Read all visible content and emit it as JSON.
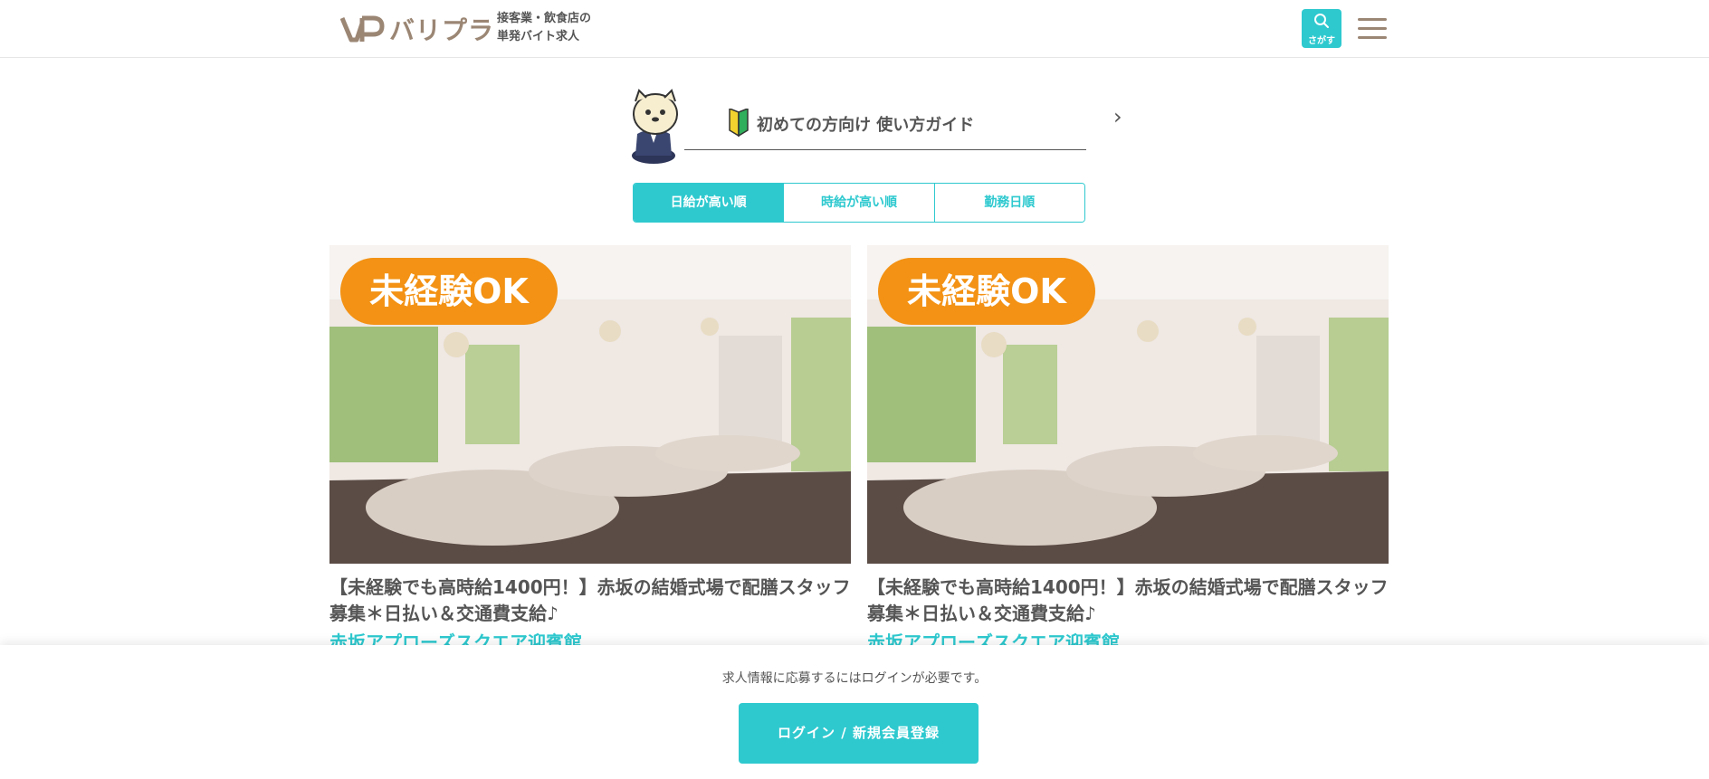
{
  "header": {
    "logo_text": "バリプラ",
    "tagline_line1": "接客業・飲食店の",
    "tagline_line2": "単発バイト求人",
    "search_label": "さがす"
  },
  "guide": {
    "text": "初めての方向け 使い方ガイド"
  },
  "sort_tabs": [
    {
      "label": "日給が高い順",
      "active": true
    },
    {
      "label": "時給が高い順",
      "active": false
    },
    {
      "label": "勤務日順",
      "active": false
    }
  ],
  "jobs": [
    {
      "badge": "未経験OK",
      "title": "【未経験でも高時給1400円！】赤坂の結婚式場で配膳スタッフ募集＊日払い＆交通費支給♪",
      "venue": "赤坂アプローズスクエア迎賓館"
    },
    {
      "badge": "未経験OK",
      "title": "【未経験でも高時給1400円！】赤坂の結婚式場で配膳スタッフ募集＊日払い＆交通費支給♪",
      "venue": "赤坂アプローズスクエア迎賓館"
    }
  ],
  "bottom_bar": {
    "notice": "求人情報に応募するにはログインが必要です。",
    "login_label": "ログイン / 新規会員登録"
  },
  "colors": {
    "accent": "#2ec9cf",
    "brand": "#9b8674",
    "badge": "#f39214"
  }
}
